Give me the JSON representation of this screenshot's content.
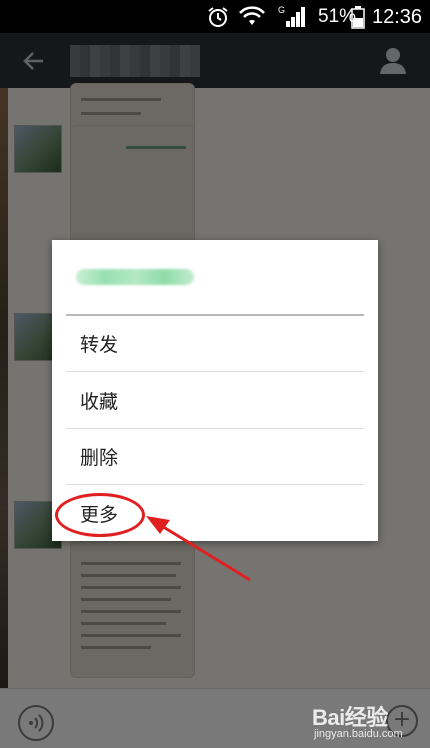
{
  "status_bar": {
    "battery_percent": "51%",
    "time": "12:36",
    "network_type": "G",
    "icons": [
      "alarm-icon",
      "wifi-icon",
      "signal-icon",
      "battery-icon"
    ]
  },
  "context_menu": {
    "items": [
      {
        "label": "转发"
      },
      {
        "label": "收藏"
      },
      {
        "label": "删除"
      },
      {
        "label": "更多"
      }
    ]
  },
  "annotation": {
    "color": "#e02020",
    "highlighted_item": "更多"
  },
  "watermark": {
    "brand": "Bai经验",
    "url": "jingyan.baidu.com"
  },
  "colors": {
    "titlebar": "#2b2e33",
    "menu_bg": "#ffffff",
    "annotation": "#e02020"
  }
}
